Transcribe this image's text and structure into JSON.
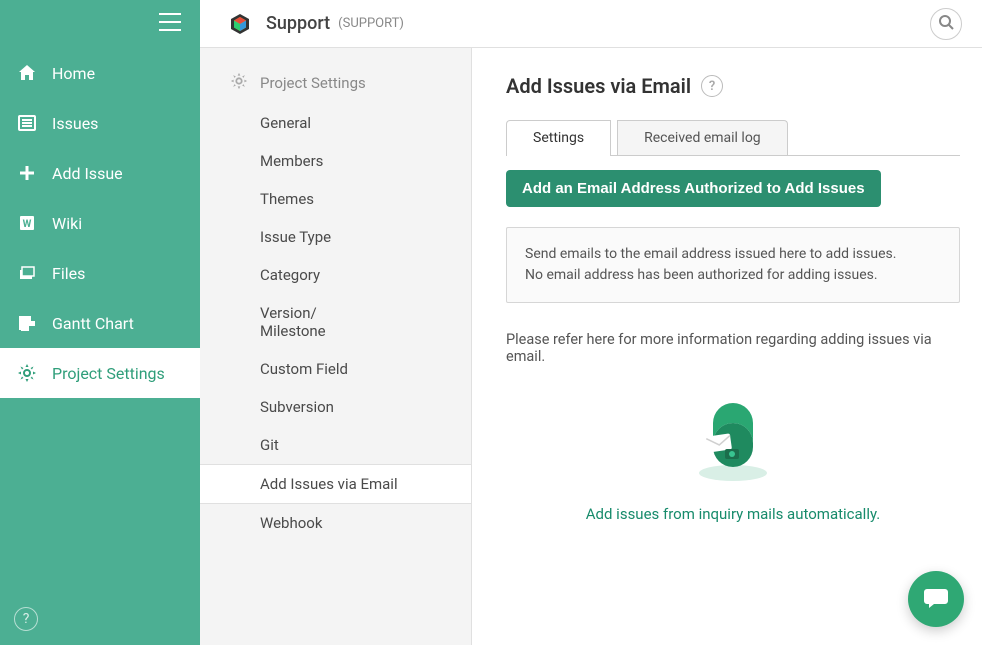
{
  "header": {
    "project_name": "Support",
    "project_code": "(SUPPORT)"
  },
  "sidebar": {
    "items": [
      {
        "label": "Home",
        "icon": "home"
      },
      {
        "label": "Issues",
        "icon": "list"
      },
      {
        "label": "Add Issue",
        "icon": "plus"
      },
      {
        "label": "Wiki",
        "icon": "wiki"
      },
      {
        "label": "Files",
        "icon": "files"
      },
      {
        "label": "Gantt Chart",
        "icon": "gantt"
      },
      {
        "label": "Project Settings",
        "icon": "gear"
      }
    ],
    "help_glyph": "?"
  },
  "settings_nav": {
    "header": "Project Settings",
    "items": [
      "General",
      "Members",
      "Themes",
      "Issue Type",
      "Category",
      "Version/\nMilestone",
      "Custom Field",
      "Subversion",
      "Git",
      "Add Issues via Email",
      "Webhook"
    ],
    "active_index": 9
  },
  "page": {
    "title": "Add Issues via Email",
    "help_glyph": "?",
    "tabs": [
      {
        "label": "Settings",
        "active": true
      },
      {
        "label": "Received email log",
        "active": false
      }
    ],
    "add_button": "Add an Email Address Authorized to Add Issues",
    "info_line1": "Send emails to the email address issued here to add issues.",
    "info_line2": "No email address has been authorized for adding issues.",
    "note": "Please refer here for more information regarding adding issues via email.",
    "link_text": "Add issues from inquiry mails automatically."
  },
  "colors": {
    "primary_sidebar": "#4caf93",
    "accent_button": "#2c8f70",
    "link": "#178b6b",
    "chat_fab": "#2fa874"
  }
}
